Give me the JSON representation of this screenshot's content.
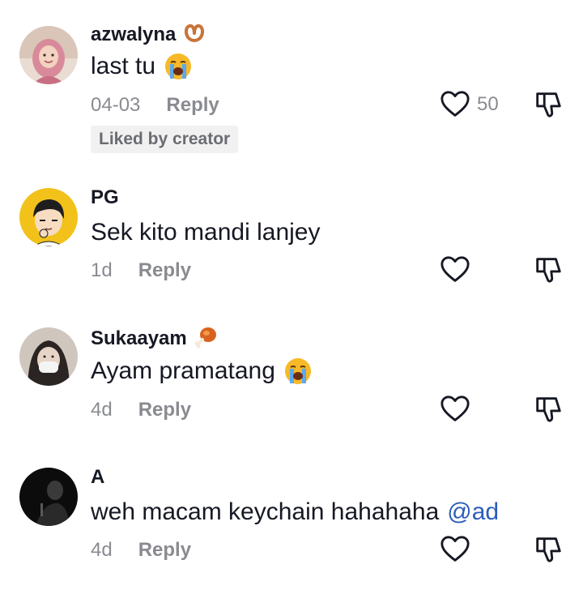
{
  "comments": [
    {
      "username": "azwalyna",
      "badge_icon": "pretzel-icon",
      "text": "last tu",
      "text_emoji": "loudly-crying-face-icon",
      "date": "04-03",
      "reply_label": "Reply",
      "like_count": "50",
      "liked_by_creator": "Liked by creator"
    },
    {
      "username": "PG",
      "text": "Sek kito mandi lanjey",
      "date": "1d",
      "reply_label": "Reply"
    },
    {
      "username": "Sukaayam",
      "badge_icon": "poultry-leg-icon",
      "text": "Ayam pramatang",
      "text_emoji": "loudly-crying-face-icon",
      "date": "4d",
      "reply_label": "Reply"
    },
    {
      "username": "A",
      "text": "weh macam keychain hahahaha",
      "mention": "@ad",
      "date": "4d",
      "reply_label": "Reply"
    }
  ],
  "colors": {
    "text": "#161823",
    "muted": "#8a8b91",
    "mention": "#2b5db9",
    "badge_bg": "#f1f1f2"
  }
}
